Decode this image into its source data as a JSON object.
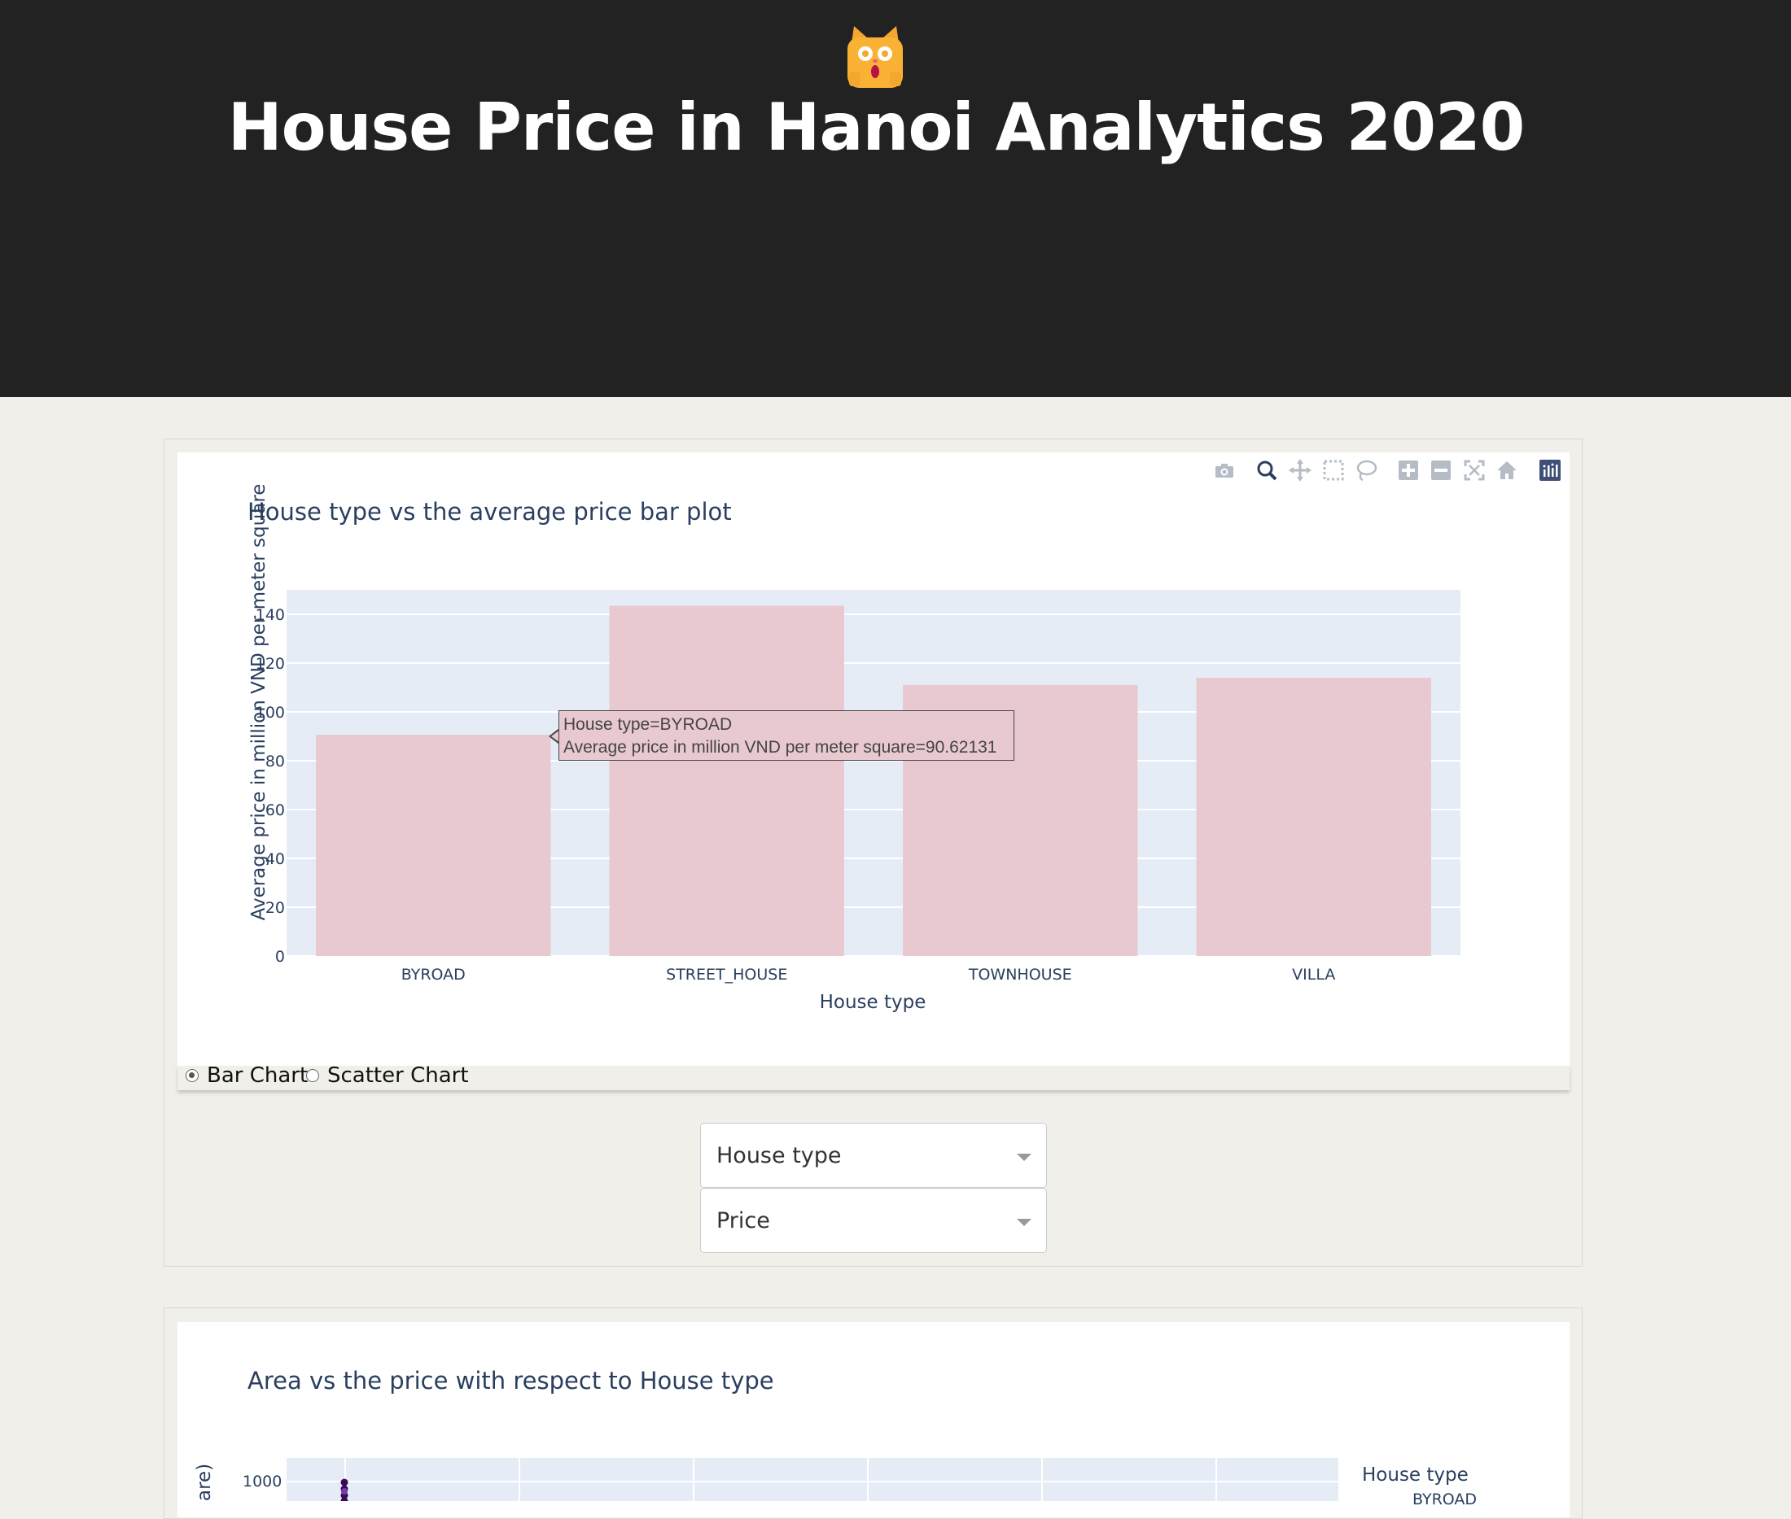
{
  "header": {
    "logo_icon": "surprised-cat-emoji-icon",
    "title": "House Price in Hanoi Analytics 2020",
    "background": "#222222"
  },
  "modebar": {
    "icons": [
      "camera-icon",
      "zoom-icon",
      "pan-icon",
      "box-select-icon",
      "lasso-select-icon",
      "zoom-in-icon",
      "zoom-out-icon",
      "autoscale-icon",
      "reset-axes-icon",
      "plotly-logo-icon"
    ]
  },
  "bar_plot": {
    "tooltip": {
      "line1": "House type=BYROAD",
      "line2": "Average price in million VND per meter square=90.62131"
    }
  },
  "chart_data": [
    {
      "type": "bar",
      "title": "House type vs the average price bar plot",
      "xlabel": "House type",
      "ylabel": "Average price in million VND per meter square",
      "categories": [
        "BYROAD",
        "STREET_HOUSE",
        "TOWNHOUSE",
        "VILLA"
      ],
      "values": [
        90.62131,
        143.5,
        111,
        114
      ],
      "ylim": [
        0,
        150
      ],
      "yticks": [
        "0",
        "20",
        "40",
        "60",
        "80",
        "100",
        "120",
        "140"
      ],
      "bar_color": "#e8c9d0",
      "plot_bg": "#e5ecf6",
      "grid": true
    },
    {
      "type": "scatter",
      "title": "Area vs the price with respect to House type",
      "ylabel_partial": "are)",
      "visible_ytick": "1000",
      "legend_title": "House type",
      "legend_partial_item": "BYROAD",
      "plot_bg": "#e5ecf6"
    }
  ],
  "chart_type_selector": {
    "options": [
      {
        "label": "Bar Chart",
        "checked": true
      },
      {
        "label": "Scatter Chart",
        "checked": false
      }
    ]
  },
  "dropdowns": {
    "x_axis": {
      "value": "House type"
    },
    "y_axis": {
      "value": "Price"
    }
  }
}
